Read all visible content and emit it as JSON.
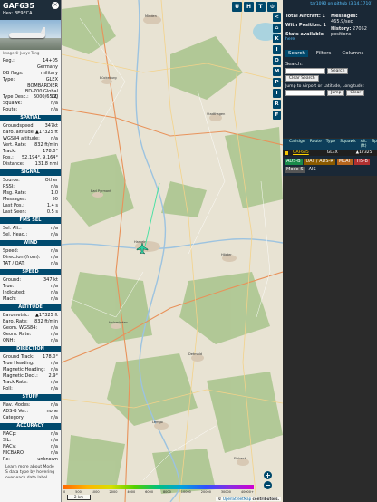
{
  "aircraft": {
    "callsign": "GAF635",
    "hex_line": "Hex: 3E9ECA",
    "photo_credit": "Image © Jupyc Tang",
    "rows_top": [
      {
        "k": "Reg.:",
        "v": "14+05"
      },
      {
        "k": "",
        "v": "Germany"
      },
      {
        "k": "DB flags:",
        "v": "military"
      },
      {
        "k": "Type:",
        "v": "GLEX"
      }
    ],
    "type_desc": "BOMBARDIER BD-700 Global 6000/6500",
    "rows_mid": [
      {
        "k": "Type Desc.:",
        "v": "L2J"
      },
      {
        "k": "Squawk:",
        "v": "n/a"
      },
      {
        "k": "Route:",
        "v": "n/a"
      }
    ],
    "sections": [
      {
        "title": "SPATIAL",
        "rows": [
          {
            "k": "Groundspeed:",
            "v": "347kt"
          },
          {
            "k": "Baro. altitude:",
            "v": "▲17325 ft"
          },
          {
            "k": "WGS84 altitude:",
            "v": "n/a"
          },
          {
            "k": "Vert. Rate:",
            "v": "832 ft/min"
          },
          {
            "k": "Track:",
            "v": "178.0°"
          },
          {
            "k": "Pos.:",
            "v": "52.194°, 9.164°"
          },
          {
            "k": "Distance:",
            "v": "131.8 nmi"
          }
        ]
      },
      {
        "title": "SIGNAL",
        "rows": [
          {
            "k": "Source:",
            "v": "Other"
          },
          {
            "k": "RSSI:",
            "v": "n/a"
          },
          {
            "k": "Msg. Rate:",
            "v": "1.0"
          },
          {
            "k": "Messages:",
            "v": "50"
          },
          {
            "k": "Last Pos.:",
            "v": "1.4 s"
          },
          {
            "k": "Last Seen:",
            "v": "0.5 s"
          }
        ]
      },
      {
        "title": "FMS SEL",
        "rows": [
          {
            "k": "Sel. Alt.:",
            "v": "n/a"
          },
          {
            "k": "Sel. Head.:",
            "v": "n/a"
          }
        ]
      },
      {
        "title": "WIND",
        "rows": [
          {
            "k": "Speed:",
            "v": "n/a"
          },
          {
            "k": "Direction (from):",
            "v": "n/a"
          },
          {
            "k": "TAT / OAT:",
            "v": "n/a"
          }
        ]
      },
      {
        "title": "SPEED",
        "rows": [
          {
            "k": "Ground:",
            "v": "347 kt"
          },
          {
            "k": "True:",
            "v": "n/a"
          },
          {
            "k": "Indicated:",
            "v": "n/a"
          },
          {
            "k": "Mach:",
            "v": "n/a"
          }
        ]
      },
      {
        "title": "ALTITUDE",
        "rows": [
          {
            "k": "Barometric:",
            "v": "▲17325 ft"
          },
          {
            "k": "Baro. Rate:",
            "v": "832 ft/min"
          },
          {
            "k": "Geom. WGS84:",
            "v": "n/a"
          },
          {
            "k": "Geom. Rate:",
            "v": "n/a"
          },
          {
            "k": "QNH:",
            "v": "n/a"
          }
        ]
      },
      {
        "title": "DIRECTION",
        "rows": [
          {
            "k": "Ground Track:",
            "v": "178.0°"
          },
          {
            "k": "True Heading:",
            "v": "n/a"
          },
          {
            "k": "Magnetic Heading:",
            "v": "n/a"
          },
          {
            "k": "Magnetic Decl.:",
            "v": "2.9°"
          },
          {
            "k": "Track Rate:",
            "v": "n/a"
          },
          {
            "k": "Roll:",
            "v": "n/a"
          }
        ]
      },
      {
        "title": "STUFF",
        "rows": [
          {
            "k": "Nav. Modes:",
            "v": "n/a"
          },
          {
            "k": "ADS-B Ver.:",
            "v": "none"
          },
          {
            "k": "Category:",
            "v": "n/a"
          }
        ]
      },
      {
        "title": "ACCURACY",
        "rows": [
          {
            "k": "NACp:",
            "v": "n/a"
          },
          {
            "k": "SIL:",
            "v": "n/a"
          },
          {
            "k": "NACv:",
            "v": "n/a"
          },
          {
            "k": "NICBARO:",
            "v": "n/a"
          },
          {
            "k": "Rc:",
            "v": "unknown"
          }
        ]
      }
    ],
    "note": "Learn more about Mode S data type by hovering over each data label."
  },
  "map": {
    "top_buttons": [
      "U",
      "H",
      "T"
    ],
    "side_buttons": [
      "<",
      "⌂",
      "K",
      "I",
      "O",
      "M",
      "P",
      "I",
      "R",
      "F"
    ],
    "zoom_in": "+",
    "zoom_out": "−",
    "altitude_labels": [
      "0",
      "500",
      "1000",
      "2000",
      "4000",
      "6000",
      "8000",
      "10000",
      "20000",
      "30000",
      "40000+"
    ],
    "scale_label": "2 km",
    "attribution_prefix": "© ",
    "attribution_link": "OpenStreetMap",
    "attribution_suffix": " contributors.",
    "cities": [
      "Minden",
      "Bückeburg",
      "Stadthagen",
      "Hameln",
      "Bad Pyrmont",
      "Höxter",
      "Holzminden",
      "Detmold",
      "Lemgo",
      "Einbeck"
    ]
  },
  "stats": {
    "version": "tar1090 on github (3.14.1710)",
    "total_aircraft_label": "Total Aircraft:",
    "total_aircraft_value": "1",
    "with_position_label": "With Position:",
    "with_position_value": "1",
    "stats_available": "Stats available",
    "stats_link": "here",
    "messages_label": "Messages:",
    "messages_value": "465.9/sec",
    "history_label": "History:",
    "history_value": "27052 positions",
    "tabs": [
      "Search",
      "Filters",
      "Columns"
    ],
    "search_label": "Search:",
    "search_button": "Search",
    "clear_search": "Clear Search",
    "jump_label": "Jump to Airport or Latitude, Longitude:",
    "jump_button": "Jump",
    "clear_button": "Clear",
    "table_headers": [
      "Callsign",
      "Route",
      "Type",
      "Squawk",
      "Alt. (ft)",
      "Spd"
    ],
    "table_row": {
      "callsign": "GAF635",
      "type": "GLEX",
      "alt": "▲17325"
    },
    "legend": [
      {
        "label": "ADS-B",
        "color": "#1a8a4a"
      },
      {
        "label": "UAT / ADS-R",
        "color": "#8a5a00"
      },
      {
        "label": "MLAT",
        "color": "#b5651d"
      },
      {
        "label": "TIS-B",
        "color": "#b03030"
      },
      {
        "label": "Mode-S",
        "color": "#555555"
      },
      {
        "label": "AIS",
        "color": "#1a2836"
      }
    ]
  }
}
